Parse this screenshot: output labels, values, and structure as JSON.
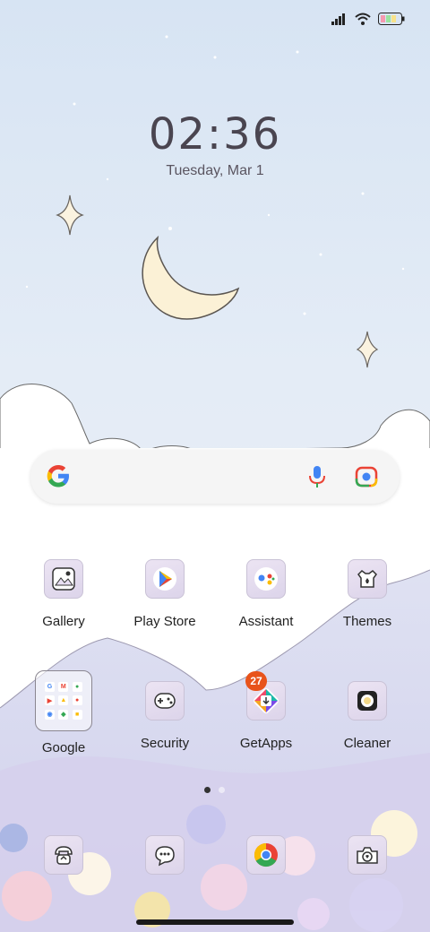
{
  "status": {
    "signal_icon": "signal-bars-icon",
    "wifi_icon": "wifi-icon",
    "battery_icon": "battery-icon"
  },
  "clock": {
    "time": "02:36",
    "date": "Tuesday, Mar 1"
  },
  "search": {
    "google_icon": "google-g-icon",
    "mic_icon": "mic-icon",
    "lens_icon": "lens-icon"
  },
  "row1": [
    {
      "label": "Gallery",
      "icon": "gallery-icon"
    },
    {
      "label": "Play Store",
      "icon": "play-store-icon"
    },
    {
      "label": "Assistant",
      "icon": "assistant-icon"
    },
    {
      "label": "Themes",
      "icon": "themes-icon"
    }
  ],
  "row2": [
    {
      "label": "Google",
      "icon": "google-folder-icon"
    },
    {
      "label": "Security",
      "icon": "security-icon"
    },
    {
      "label": "GetApps",
      "icon": "getapps-icon",
      "badge": "27"
    },
    {
      "label": "Cleaner",
      "icon": "cleaner-icon"
    }
  ],
  "dock": [
    {
      "icon": "phone-icon"
    },
    {
      "icon": "messages-icon"
    },
    {
      "icon": "chrome-icon"
    },
    {
      "icon": "camera-icon"
    }
  ],
  "page_indicator": {
    "count": 2,
    "active": 1
  },
  "colors": {
    "sky": "#dfe8f5",
    "moon": "#fbf1d6",
    "badge": "#e8531a"
  }
}
